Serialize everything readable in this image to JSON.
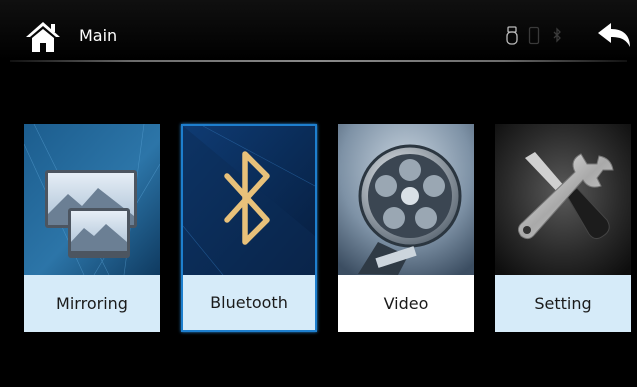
{
  "header": {
    "title": "Main",
    "icons": [
      "home-icon",
      "usb-icon",
      "phone-icon",
      "bluetooth-status-icon",
      "back-icon"
    ]
  },
  "tiles": [
    {
      "label": "Mirroring",
      "icon": "mirroring-icon",
      "selected": false
    },
    {
      "label": "Bluetooth",
      "icon": "bluetooth-icon",
      "selected": true
    },
    {
      "label": "Video",
      "icon": "film-reel-icon",
      "selected": false
    },
    {
      "label": "Setting",
      "icon": "tools-icon",
      "selected": false
    }
  ],
  "colors": {
    "background": "#000000",
    "label_bar": "#d6ebf9",
    "selected_border": "#1e7fce",
    "bluetooth_symbol": "#e8c17a"
  }
}
